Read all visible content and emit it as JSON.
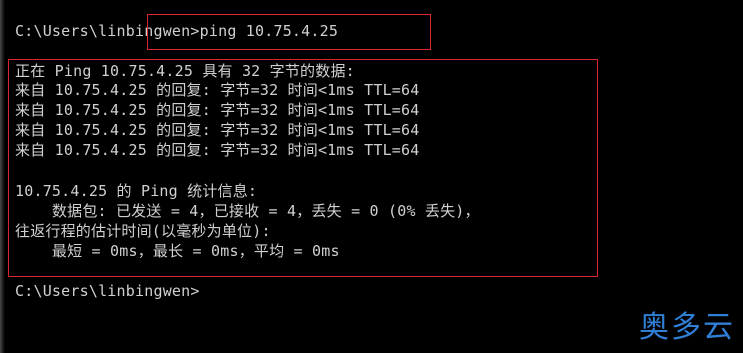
{
  "prompt_1": "C:\\Users\\linbingwen>",
  "command": "ping 10.75.4.25",
  "output": {
    "header": "正在 Ping 10.75.4.25 具有 32 字节的数据:",
    "replies": [
      "来自 10.75.4.25 的回复: 字节=32 时间<1ms TTL=64",
      "来自 10.75.4.25 的回复: 字节=32 时间<1ms TTL=64",
      "来自 10.75.4.25 的回复: 字节=32 时间<1ms TTL=64",
      "来自 10.75.4.25 的回复: 字节=32 时间<1ms TTL=64"
    ],
    "stats_title": "10.75.4.25 的 Ping 统计信息:",
    "packets": "    数据包: 已发送 = 4，已接收 = 4，丢失 = 0 (0% 丢失)，",
    "rtt_title": "往返行程的估计时间(以毫秒为单位):",
    "rtt_values": "    最短 = 0ms，最长 = 0ms，平均 = 0ms"
  },
  "prompt_2": "C:\\Users\\linbingwen>",
  "watermark": "奥多云",
  "colors": {
    "background": "#000000",
    "text": "#d0d0d0",
    "highlight": "#d8262c",
    "watermark": "#2f7fd6"
  }
}
